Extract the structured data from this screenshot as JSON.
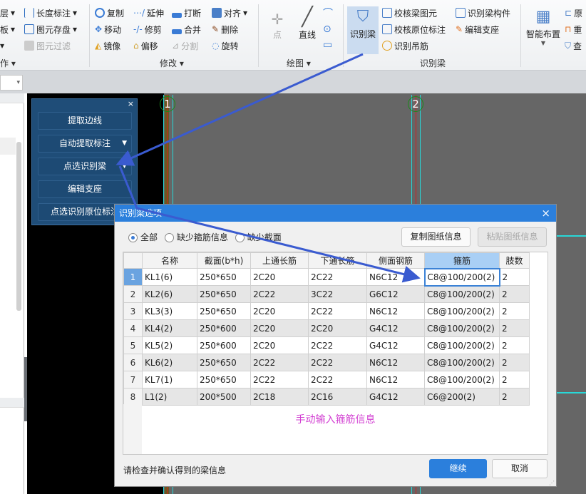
{
  "ribbon": {
    "left_partial": [
      "层",
      "板",
      "",
      "作"
    ],
    "col2": [
      "长度标注",
      "图元存盘",
      "图元过滤"
    ],
    "modify": {
      "label": "修改",
      "items": [
        "复制",
        "延伸",
        "打断",
        "对齐",
        "移动",
        "修剪",
        "合并",
        "删除",
        "镜像",
        "偏移",
        "分割",
        "旋转"
      ]
    },
    "draw": {
      "label": "绘图",
      "point": "点",
      "line": "直线"
    },
    "identify": {
      "label": "识别梁",
      "big": "识别梁",
      "items": [
        "校核梁图元",
        "校核原位标注",
        "识别吊筋",
        "识别梁构件",
        "编辑支座"
      ]
    },
    "smart": {
      "big": "智能布置",
      "items": [
        "原",
        "重",
        "查"
      ]
    }
  },
  "float_panel": {
    "buttons": [
      "提取边线",
      "自动提取标注",
      "点选识别梁",
      "编辑支座",
      "点选识别原位标注"
    ]
  },
  "canvas": {
    "axes": [
      "1",
      "2"
    ]
  },
  "dialog": {
    "title": "识别梁选项",
    "radios": [
      {
        "label": "全部",
        "checked": true
      },
      {
        "label": "缺少箍筋信息",
        "checked": false
      },
      {
        "label": "缺少截面",
        "checked": false
      }
    ],
    "copy_btn": "复制图纸信息",
    "paste_btn": "粘贴图纸信息",
    "columns": [
      "名称",
      "截面(b*h)",
      "上通长筋",
      "下通长筋",
      "侧面钢筋",
      "箍筋",
      "肢数"
    ],
    "rows": [
      [
        "1",
        "KL1(6)",
        "250*650",
        "2C20",
        "2C22",
        "N6C12",
        "C8@100/200(2)",
        "2"
      ],
      [
        "2",
        "KL2(6)",
        "250*650",
        "2C22",
        "3C22",
        "G6C12",
        "C8@100/200(2)",
        "2"
      ],
      [
        "3",
        "KL3(3)",
        "250*650",
        "2C20",
        "2C22",
        "N6C12",
        "C8@100/200(2)",
        "2"
      ],
      [
        "4",
        "KL4(2)",
        "250*600",
        "2C20",
        "2C20",
        "G4C12",
        "C8@100/200(2)",
        "2"
      ],
      [
        "5",
        "KL5(2)",
        "250*600",
        "2C20",
        "2C22",
        "G4C12",
        "C8@100/200(2)",
        "2"
      ],
      [
        "6",
        "KL6(2)",
        "250*650",
        "2C22",
        "2C22",
        "N6C12",
        "C8@100/200(2)",
        "2"
      ],
      [
        "7",
        "KL7(1)",
        "250*650",
        "2C22",
        "2C22",
        "N6C12",
        "C8@100/200(2)",
        "2"
      ],
      [
        "8",
        "L1(2)",
        "200*500",
        "2C18",
        "2C16",
        "G4C12",
        "C6@200(2)",
        "2"
      ]
    ],
    "annotation": "手动输入箍筋信息",
    "status": "请检查并确认得到的梁信息",
    "continue_btn": "继续",
    "cancel_btn": "取消"
  },
  "colors": {
    "accent": "#2b7fdc",
    "annotation": "#d23fd2",
    "arrow": "#3a5bd0"
  }
}
